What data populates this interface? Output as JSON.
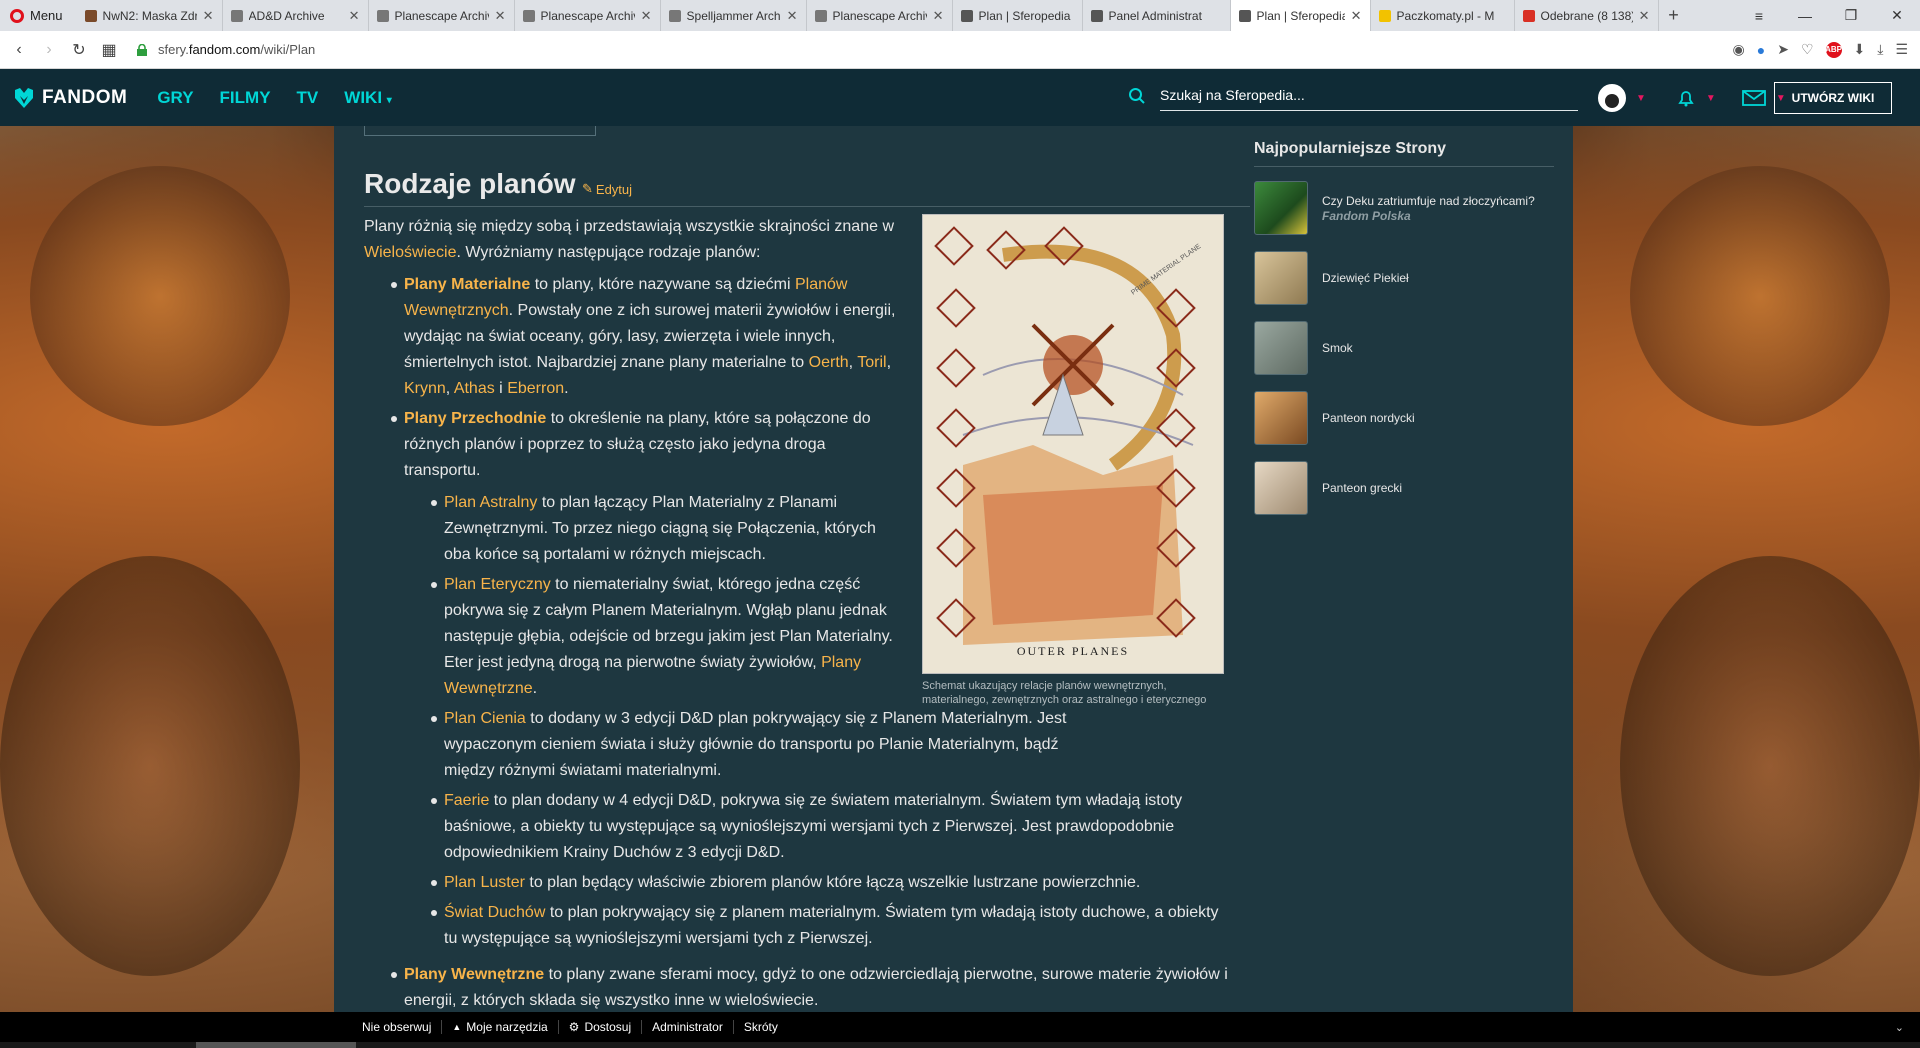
{
  "browser": {
    "menu_label": "Menu",
    "tabs": [
      {
        "label": "NwN2: Maska Zdr",
        "color": "#7a4a2a"
      },
      {
        "label": "AD&D Archive",
        "color": "#777777"
      },
      {
        "label": "Planescape Archiv",
        "color": "#777777"
      },
      {
        "label": "Planescape Archiv",
        "color": "#777777"
      },
      {
        "label": "Spelljammer Archi",
        "color": "#777777"
      },
      {
        "label": "Planescape Archiv",
        "color": "#777777"
      },
      {
        "label": "Plan | Sferopedia",
        "color": "#555555"
      },
      {
        "label": "Panel Administrat",
        "color": "#555555"
      },
      {
        "label": "Plan | Sferopedia",
        "color": "#555555"
      },
      {
        "label": "Paczkomaty.pl - M",
        "color": "#f2c200"
      },
      {
        "label": "Odebrane (8 138)",
        "color": "#d93025"
      }
    ],
    "url_prefix": "sfery.",
    "url_domain": "fandom.com",
    "url_path": "/wiki/Plan",
    "abp_label": "ABP"
  },
  "fandom_nav": {
    "logo": "FANDOM",
    "links": [
      "GRY",
      "FILMY",
      "TV",
      "WIKI"
    ],
    "search_placeholder": "Szukaj na Sferopedia...",
    "create_button": "UTWÓRZ WIKI"
  },
  "article": {
    "section_title": "Rodzaje planów",
    "edit_label": "Edytuj",
    "intro_1": "Plany różnią się między sobą i przedstawiają wszystkie skrajności znane w ",
    "intro_link": "Wieloświecie",
    "intro_2": ". Wyróżniamy następujące rodzaje planów:",
    "material": {
      "title": "Plany Materialne",
      "t1": " to plany, które nazywane są dziećmi ",
      "link1": "Planów Wewnętrznych",
      "t2": ". Powstały one z ich surowej materii żywiołów i energii, wydając na świat oceany, góry, lasy, zwierzęta i wiele innych, śmiertelnych istot. Najbardziej znane plany materialne to ",
      "link_oerth": "Oerth",
      "sep1": ", ",
      "link_toril": "Toril",
      "sep2": ", ",
      "link_krynn": "Krynn",
      "sep3": ", ",
      "link_athas": "Athas",
      "sep4": " i ",
      "link_eberron": "Eberron",
      "end": "."
    },
    "transitive": {
      "title": "Plany Przechodnie",
      "text": " to określenie na plany, które są połączone do różnych planów i poprzez to służą często jako jedyna droga transportu.",
      "sub": [
        {
          "link": "Plan Astralny",
          "text": " to plan łączący Plan Materialny z Planami Zewnętrznymi. To przez niego ciągną się Połączenia, których oba końce są portalami w różnych miejscach."
        },
        {
          "link": "Plan Eteryczny",
          "text": " to niematerialny świat, którego jedna część pokrywa się z całym Planem Materialnym. Wgłąb planu jednak następuje głębia, odejście od brzegu jakim jest Plan Materialny. Eter jest jedyną drogą na pierwotne światy żywiołów, ",
          "link2": "Plany Wewnętrzne",
          "end": "."
        },
        {
          "link": "Plan Cienia",
          "text": " to dodany w 3 edycji D&D plan pokrywający się z Planem Materialnym. Jest wypaczonym cieniem świata i służy głównie do transportu po Planie Materialnym, bądź między różnymi światami materialnymi."
        },
        {
          "link": "Faerie",
          "text": " to plan dodany w 4 edycji D&D, pokrywa się ze światem materialnym. Światem tym władają istoty baśniowe, a obiekty tu występujące są wynioślejszymi wersjami tych z Pierwszej. Jest prawdopodobnie odpowiednikiem Krainy Duchów z 3 edycji D&D."
        },
        {
          "link": "Plan Luster",
          "text": " to plan będący właściwie zbiorem planów które łączą wszelkie lustrzane powierzchnie."
        },
        {
          "link": "Świat Duchów",
          "text": " to plan pokrywający się z planem materialnym. Światem tym władają istoty duchowe, a obiekty tu występujące są wynioślejszymi wersjami tych z Pierwszej."
        }
      ]
    },
    "inner": {
      "title": "Plany Wewnętrzne",
      "text": " to plany zwane sferami mocy, gdyż to one odzwierciedlają pierwotne, surowe materie żywiołów i energii, z których składa się wszystko inne w wieloświecie."
    },
    "figure": {
      "caption": "Schemat ukazujący relacje planów wewnętrznych, materialnego, zewnętrznych oraz astralnego i eterycznego",
      "label": "OUTER PLANES",
      "arc_label": "PRIME MATERIAL PLANE"
    }
  },
  "rail": {
    "title": "Najpopularniejsze Strony",
    "items": [
      {
        "title": "Czy Deku zatriumfuje nad złoczyńcami?",
        "sub": "Fandom Polska",
        "color": "#3c8a3c"
      },
      {
        "title": "Dziewięć Piekieł",
        "sub": "",
        "color": "#b9a37a"
      },
      {
        "title": "Smok",
        "sub": "",
        "color": "#7f8c84"
      },
      {
        "title": "Panteon nordycki",
        "sub": "",
        "color": "#c8925a"
      },
      {
        "title": "Panteon grecki",
        "sub": "",
        "color": "#cbb9a3"
      }
    ]
  },
  "toolbar": {
    "items": [
      "Nie obserwuj",
      "Moje narzędzia",
      "Dostosuj",
      "Administrator",
      "Skróty"
    ]
  },
  "colors": {
    "link": "#f8b44a",
    "fandom_nav": "#0f2b36",
    "fandom_accent": "#00d6d6",
    "content_bg": "#1e3740"
  }
}
